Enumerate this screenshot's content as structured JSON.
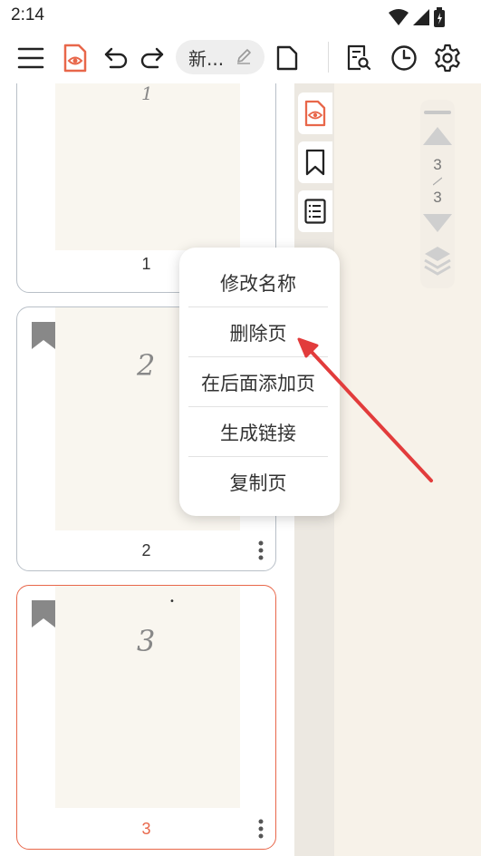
{
  "status_bar": {
    "time": "2:14"
  },
  "toolbar": {
    "title": "新...",
    "icons": [
      "menu-icon",
      "reading-mode-icon",
      "undo-icon",
      "redo-icon",
      "edit-icon",
      "page-size-icon",
      "search-doc-icon",
      "history-icon",
      "settings-icon"
    ]
  },
  "pages": [
    {
      "number": "1",
      "content": "1"
    },
    {
      "number": "2",
      "content": "2"
    },
    {
      "number": "3",
      "content": "3"
    }
  ],
  "context_menu": {
    "items": [
      "修改名称",
      "删除页",
      "在后面添加页",
      "生成链接",
      "复制页"
    ]
  },
  "scroll_control": {
    "current": "3",
    "total": "3"
  },
  "colors": {
    "accent": "#e8674a",
    "arrow": "#e23c3c",
    "paper": "#f9f6ef",
    "canvas": "#f7f2e9"
  }
}
